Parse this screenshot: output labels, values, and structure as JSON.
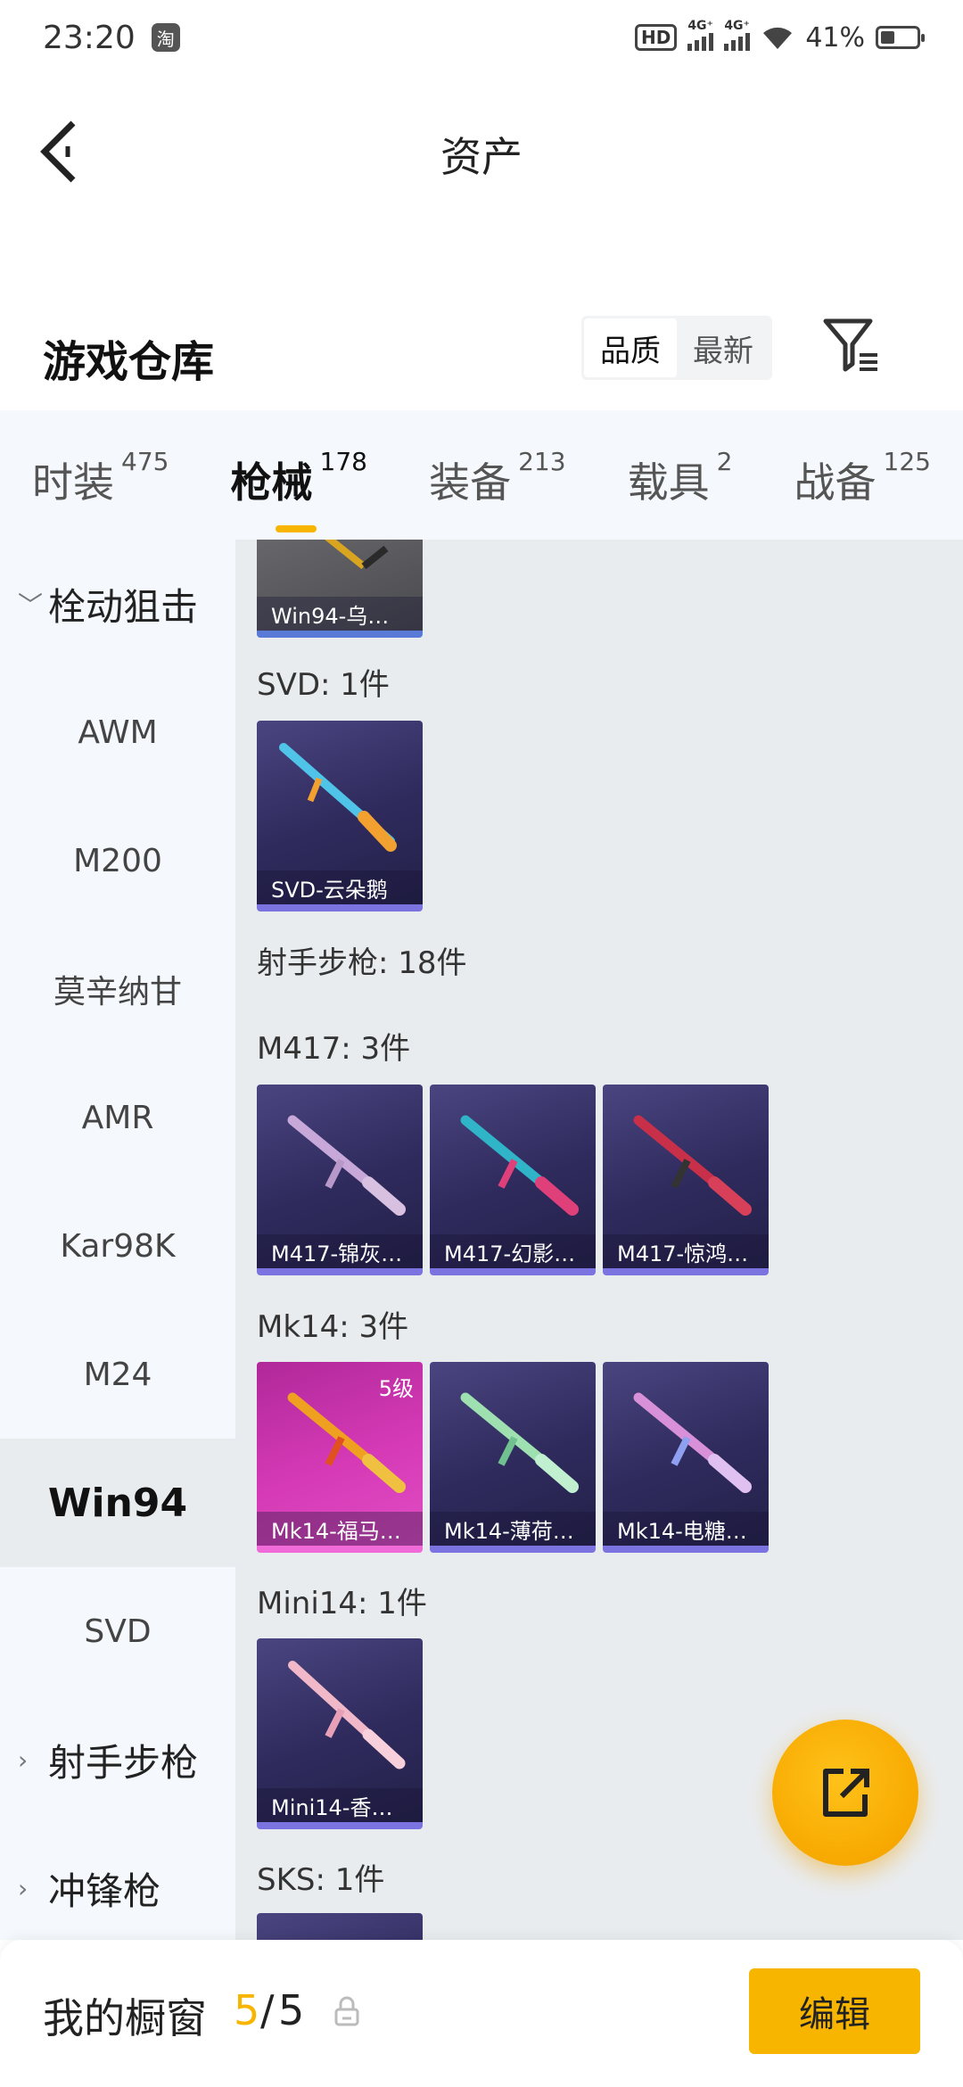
{
  "status_bar": {
    "time": "23:20",
    "app_badge": "淘",
    "hd": "HD",
    "net1": "4G⁺",
    "net2": "4G⁺",
    "battery": "41%"
  },
  "header": {
    "title": "资产"
  },
  "warehouse": {
    "title": "游戏仓库",
    "sort_quality": "品质",
    "sort_latest": "最新"
  },
  "tabs": [
    {
      "label": "时装",
      "count": "475"
    },
    {
      "label": "枪械",
      "count": "178"
    },
    {
      "label": "装备",
      "count": "213"
    },
    {
      "label": "载具",
      "count": "2"
    },
    {
      "label": "战备",
      "count": "125"
    }
  ],
  "side_nav": {
    "group_bolt": "栓动狙击",
    "items": [
      "AWM",
      "M200",
      "莫辛纳甘",
      "AMR",
      "Kar98K",
      "M24",
      "Win94",
      "SVD"
    ],
    "group_marksman": "射手步枪",
    "group_smg": "冲锋枪"
  },
  "content": {
    "win94_card": "Win94-乌…",
    "svd_label": "SVD: 1件",
    "svd_card": "SVD-云朵鹅",
    "marksman_label": "射手步枪: 18件",
    "m417_label": "M417: 3件",
    "m417_cards": [
      "M417-锦灰…",
      "M417-幻影…",
      "M417-惊鸿…"
    ],
    "mk14_label": "Mk14: 3件",
    "mk14_cards": [
      "Mk14-福马…",
      "Mk14-薄荷…",
      "Mk14-电糖…"
    ],
    "mk14_level": "5级",
    "mini14_label": "Mini14: 1件",
    "mini14_card": "Mini14-香…",
    "sks_label": "SKS: 1件"
  },
  "bottom_bar": {
    "showcase_label": "我的橱窗",
    "showcase_count": "5",
    "separator": "/",
    "showcase_total": "5",
    "edit_label": "编辑"
  },
  "colors": {
    "accent": "#f7b500",
    "card_bg": "#2e2a5c",
    "card_border": "#7b74e0",
    "highlight_card": "#d63ab6"
  }
}
